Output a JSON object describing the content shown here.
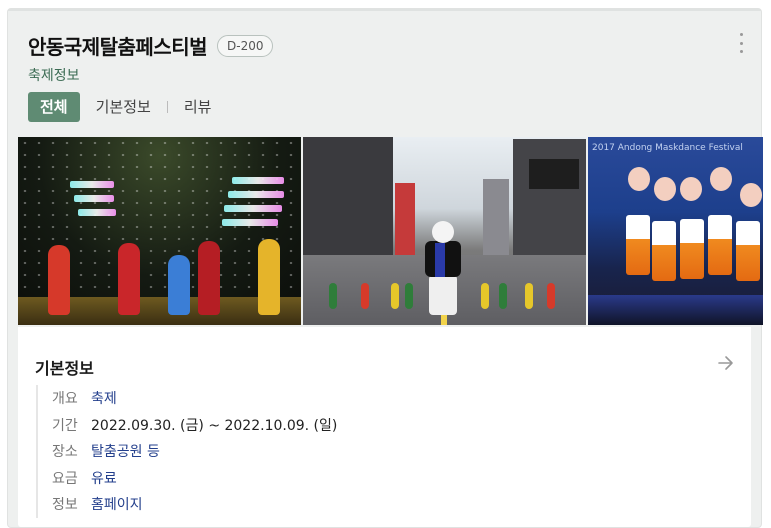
{
  "header": {
    "title": "안동국제탈춤페스티벌",
    "dday": "D-200",
    "subtitle": "축제정보"
  },
  "tabs": [
    {
      "label": "전체",
      "active": true
    },
    {
      "label": "기본정보",
      "active": false
    },
    {
      "label": "리뷰",
      "active": false
    }
  ],
  "gallery": {
    "photo3_banner": "2017 Andong Maskdance Festival"
  },
  "info": {
    "title": "기본정보",
    "rows": [
      {
        "label": "개요",
        "value": "축제"
      },
      {
        "label": "기간",
        "value": "2022.09.30. (금) ~ 2022.10.09. (일)"
      },
      {
        "label": "장소",
        "value": "탈춤공원 등"
      },
      {
        "label": "요금",
        "value": "유료"
      },
      {
        "label": "정보",
        "value": "홈페이지"
      }
    ]
  },
  "colors": {
    "accent": "#5f8b73",
    "link": "#233f8c",
    "card_bg": "#eef0ef"
  },
  "icons": {
    "more": "vertical-dots-icon",
    "arrow": "arrow-right-icon"
  }
}
